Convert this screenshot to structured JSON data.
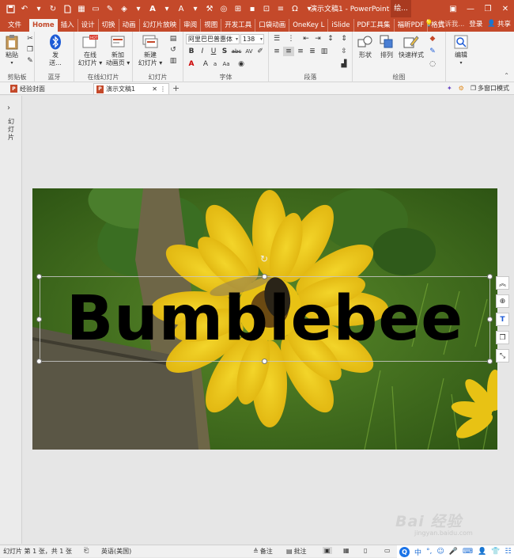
{
  "window": {
    "title": "演示文稿1 - PowerPoint",
    "context_tab": "绘..."
  },
  "tabs": [
    {
      "label": "文件"
    },
    {
      "label": "Home"
    },
    {
      "label": "插入"
    },
    {
      "label": "设计"
    },
    {
      "label": "切换"
    },
    {
      "label": "动画"
    },
    {
      "label": "幻灯片放映"
    },
    {
      "label": "审阅"
    },
    {
      "label": "视图"
    },
    {
      "label": "开发工具"
    },
    {
      "label": "口袋动画"
    },
    {
      "label": "OneKey L"
    },
    {
      "label": "iSlide"
    },
    {
      "label": "PDF工具集"
    },
    {
      "label": "福昕PDF"
    },
    {
      "label": "格式"
    }
  ],
  "tab_right": {
    "tell_me": "告诉我...",
    "login": "登录",
    "share": "共享"
  },
  "ribbon": {
    "clipboard": {
      "label": "剪贴板",
      "paste": "粘贴"
    },
    "bluetooth": {
      "label": "蓝牙",
      "send_line1": "发",
      "send_line2": "送..."
    },
    "online_slides": {
      "label": "在线幻灯片",
      "online_line1": "在线",
      "online_line2": "幻灯片 ▾",
      "new_line1": "新加",
      "new_line2": "动画页 ▾"
    },
    "slides": {
      "label": "幻灯片",
      "new_line1": "新建",
      "new_line2": "幻灯片 ▾"
    },
    "font": {
      "label": "字体",
      "font_name": "阿里巴巴普惠体",
      "font_size": "138"
    },
    "paragraph": {
      "label": "段落"
    },
    "drawing": {
      "label": "绘图",
      "shapes": "形状",
      "arrange": "排列",
      "quick_styles": "快速样式"
    },
    "editing": {
      "label": "",
      "edit": "编辑"
    }
  },
  "doc_tabs": [
    {
      "label": "经验封面"
    },
    {
      "label": "演示文稿1"
    }
  ],
  "doc_tabs_right": {
    "multi_window": "多窗口模式"
  },
  "side_pane": {
    "label": "幻灯片"
  },
  "slide": {
    "text": "Bumblebee"
  },
  "status": {
    "slide_info": "幻灯片 第 1 张，共 1 张",
    "language": "英语(美国)",
    "notes": "备注",
    "comments": "批注"
  },
  "ime": {
    "mode": "中"
  },
  "watermark": {
    "brand": "Bai 经验",
    "url": "jingyan.baidu.com"
  },
  "colors": {
    "accent": "#c4492a",
    "ribbon": "#f3f3f3"
  }
}
